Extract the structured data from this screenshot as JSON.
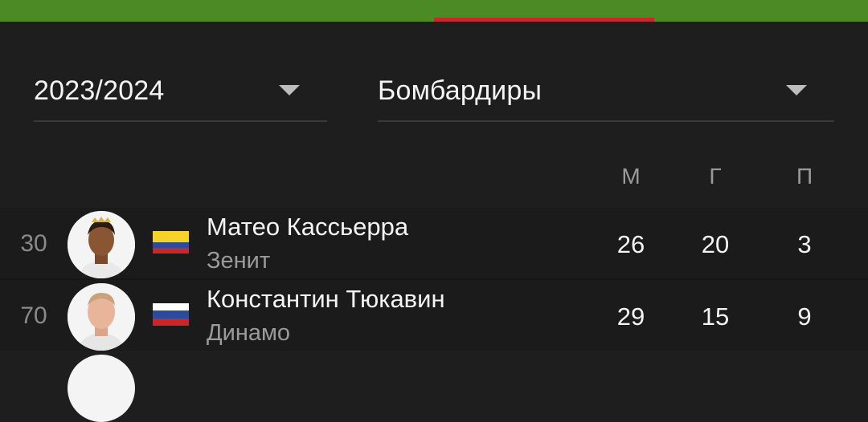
{
  "filters": {
    "season": "2023/2024",
    "stat_type": "Бомбардиры"
  },
  "columns": [
    "М",
    "Г",
    "П"
  ],
  "players": [
    {
      "number": "30",
      "name": "Матео Кассьерра",
      "team": "Зенит",
      "flag": "colombia",
      "matches": "26",
      "goals": "20",
      "assists": "3"
    },
    {
      "number": "70",
      "name": "Константин Тюкавин",
      "team": "Динамо",
      "flag": "russia",
      "matches": "29",
      "goals": "15",
      "assists": "9"
    }
  ],
  "colors": {
    "top_bar": "#4c8a25",
    "tab_indicator": "#c8272d",
    "background": "#1e1e1e"
  }
}
